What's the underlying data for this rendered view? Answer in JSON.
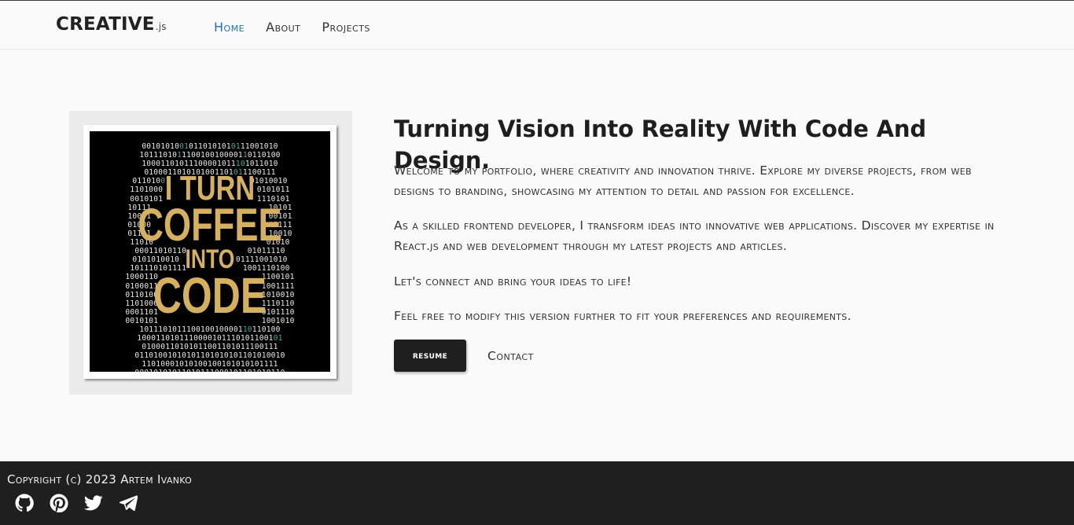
{
  "brand": {
    "name": "CREATIVE",
    "suffix": ".js"
  },
  "nav": {
    "items": [
      {
        "label": "Home",
        "active": true
      },
      {
        "label": "About",
        "active": false
      },
      {
        "label": "Projects",
        "active": false
      }
    ],
    "active_color": "#1f6fd0"
  },
  "hero_image": {
    "lines": [
      "I TURN",
      "COFFEE",
      "INTO",
      "CODE"
    ],
    "text_color": "#d6b15a"
  },
  "main": {
    "heading": "Turning Vision Into Reality With Code And Design.",
    "paragraphs": [
      "Welcome to my portfolio, where creativity and innovation thrive. Explore my diverse projects, from web designs to branding, showcasing my attention to detail and passion for excellence.",
      "As a skilled frontend developer, I transform ideas into innovative web applications. Discover my expertise in React.js and web development through my latest projects and articles.",
      "Let's connect and bring your ideas to life!",
      "Feel free to modify this version further to fit your preferences and requirements."
    ],
    "resume_label": "resume",
    "contact_label": "Contact"
  },
  "footer": {
    "copyright": "Copyright (c) 2023 Artem Ivanko",
    "socials": [
      "github-icon",
      "pinterest-icon",
      "twitter-icon",
      "telegram-icon"
    ]
  }
}
